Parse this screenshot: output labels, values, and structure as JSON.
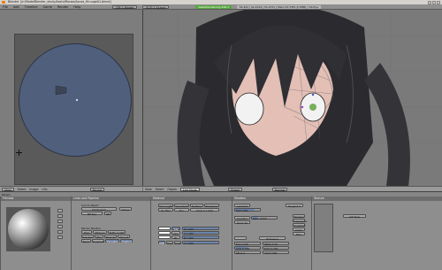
{
  "window": {
    "title": "Blender [/rr/ModelBlender_study/Aoshi/Mouse/Azusa_Hiruuge01.blend]"
  },
  "menu": {
    "items": [
      "File",
      "Add",
      "Timeline",
      "Game",
      "Render",
      "Help"
    ],
    "screen": "SR:1-Model",
    "scene": "SCE:1-Scene",
    "green_info": "www.blender.org 249.1",
    "stats": "Fa:441 | Ve:1544 | Fa:1531 | Mem:33.33M (0.3MB) | Ob:Eye"
  },
  "uv_header": {
    "items": [
      "View",
      "Select",
      "Image",
      "UVs"
    ],
    "pivot": "Bound"
  },
  "view_header": {
    "items": [
      "View",
      "Select",
      "Object"
    ],
    "mode": "Edit Mode",
    "global": "Global",
    "pivot_label": "Normal"
  },
  "bottom_header": {
    "panels": "Panels",
    "tabs": [
      "Shading",
      "Material"
    ]
  },
  "preview": {
    "title": "Preview"
  },
  "links": {
    "title": "Links and Pipeline",
    "link_to": "Link to Object",
    "ma": "MA:Eyeball",
    "me": "ME:Eye",
    "ob": "OB",
    "nodes": "Nodes",
    "render_pipeline": "Render Pipeline",
    "halo": "Halo",
    "ztransp": "ZTransp",
    "zoffs": "Zoffs: 0.000",
    "full_osa": "Full Osa",
    "wire": "Wire",
    "strands": "Strands",
    "zinvert": "ZInvert",
    "radio": "Radio",
    "only_cast": "OnlyCast",
    "traceable": "Traceable",
    "shadbuf": "Shadbuf"
  },
  "material": {
    "title": "Material",
    "vcol_light": "VCol Light",
    "vcol_paint": "VCol Paint",
    "texface": "TexFace",
    "shadeless": "Shadeless",
    "no_mist": "No Mist",
    "env": "Env",
    "shad_a": "Shad A 1.000",
    "col": "Col",
    "spe": "Spe",
    "mir": "Mir",
    "r": "R 1.000",
    "g": "G 1.000",
    "b": "B 1.000",
    "a": "A 1.000",
    "rgb": "RGB",
    "hsv": "HSV",
    "dyn": "DYN"
  },
  "shaders": {
    "title": "Shaders",
    "lambert": "Lambert",
    "ref": "Ref 0.800",
    "tangent": "Tangent V",
    "cooktorr": "CookTorr",
    "spec": "Spec 0.500",
    "hard": "Hard: 50",
    "tralu": "Tralu 0.00",
    "sbias": "SBias 0.00",
    "amb": "Amb 0.500",
    "emit": "Emit 0.000",
    "lbias": "LBias 0",
    "add": "Add 0.000",
    "shadow": "Shadow",
    "traShadow": "TraShadow",
    "onlyShad": "OnlyShad",
    "cubic": "Cubic",
    "bias": "Bias",
    "exclusive": "Exclusive"
  },
  "texture": {
    "title": "Texture",
    "add_new": "Add New"
  }
}
